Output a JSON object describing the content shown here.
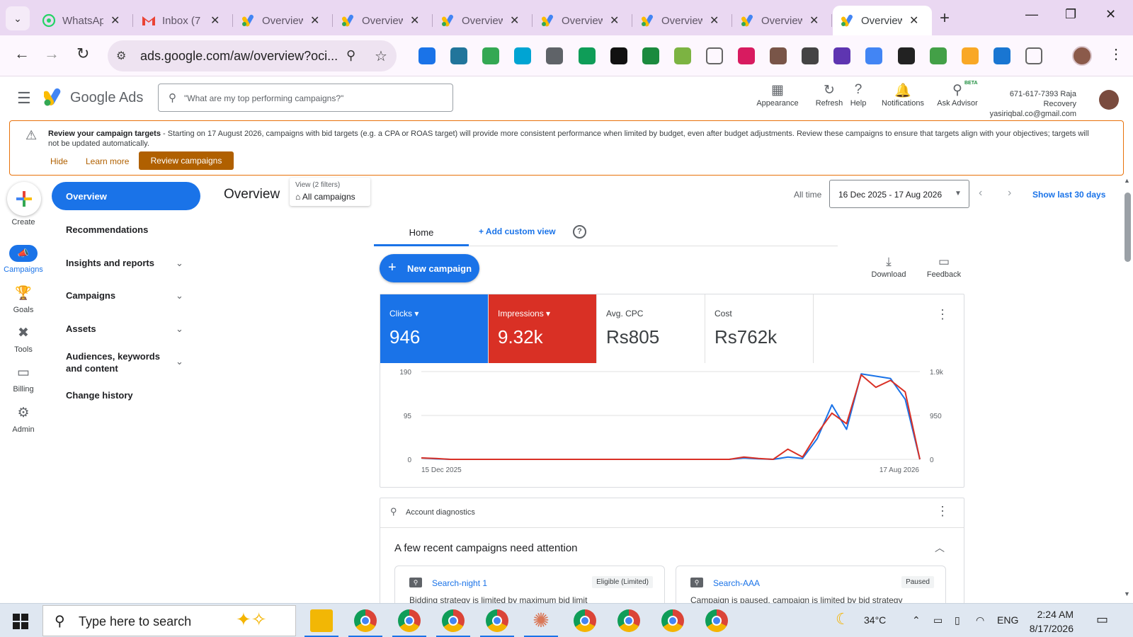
{
  "browser": {
    "tabs": [
      {
        "label": "WhatsApp",
        "icon": "whatsapp-icon",
        "color": "#25d366"
      },
      {
        "label": "Inbox (7",
        "icon": "gmail-icon",
        "color": "#ea4335"
      },
      {
        "label": "Overview",
        "icon": "google-ads-icon",
        "color": "#4285f4"
      },
      {
        "label": "Overview",
        "icon": "google-ads-icon",
        "color": "#4285f4"
      },
      {
        "label": "Overview",
        "icon": "google-ads-icon",
        "color": "#4285f4"
      },
      {
        "label": "Overview",
        "icon": "google-ads-icon",
        "color": "#4285f4"
      },
      {
        "label": "Overview",
        "icon": "google-ads-icon",
        "color": "#4285f4"
      },
      {
        "label": "Overview",
        "icon": "google-ads-icon",
        "color": "#4285f4"
      },
      {
        "label": "Overview",
        "icon": "google-ads-icon",
        "color": "#4285f4",
        "active": true
      }
    ],
    "url": "ads.google.com/aw/overview?oci..."
  },
  "ads_header": {
    "product": "Google Ads",
    "search_placeholder": "\"What are my top performing campaigns?\"",
    "tools": [
      {
        "label": "Appearance",
        "icon": "appearance-icon"
      },
      {
        "label": "Refresh",
        "icon": "refresh-icon"
      },
      {
        "label": "Help",
        "icon": "help-icon"
      },
      {
        "label": "Notifications",
        "icon": "bell-icon"
      },
      {
        "label": "Ask Advisor",
        "icon": "ask-advisor-icon"
      }
    ],
    "beta_badge": "BETA",
    "account_line1": "671-617-7393 Raja Recovery",
    "account_line2": "yasiriqbal.co@gmail.com"
  },
  "banner": {
    "title": "Review your campaign targets",
    "text": " - Starting on 17 August 2026, campaigns with bid targets (e.g. a CPA or ROAS target) will provide more consistent performance when limited by budget, even after budget adjustments. Review these campaigns to ensure that targets align with your objectives; targets will not be updated automatically.",
    "hide": "Hide",
    "learn_more": "Learn more",
    "review_btn": "Review campaigns"
  },
  "rail": {
    "create": "Create",
    "campaigns": "Campaigns",
    "goals": "Goals",
    "tools": "Tools",
    "billing": "Billing",
    "admin": "Admin"
  },
  "nav": {
    "overview": "Overview",
    "recommendations": "Recommendations",
    "insights": "Insights and reports",
    "campaigns": "Campaigns",
    "assets": "Assets",
    "audiences": "Audiences, keywords and content",
    "change_history": "Change history"
  },
  "main": {
    "title": "Overview",
    "view_filters": "View (2 filters)",
    "view_name": "All campaigns",
    "all_time": "All time",
    "date_range": "16 Dec 2025 - 17 Aug 2026",
    "show_last": "Show last 30 days",
    "home_tab": "Home",
    "add_custom_view": "Add custom view",
    "new_campaign": "New campaign",
    "download": "Download",
    "feedback": "Feedback"
  },
  "metrics": [
    {
      "label": "Clicks",
      "value": "946",
      "selected": true,
      "color": "#1a73e8"
    },
    {
      "label": "Impressions",
      "value": "9.32k",
      "selected": true,
      "color": "#d93025"
    },
    {
      "label": "Avg. CPC",
      "value": "Rs805",
      "selected": false
    },
    {
      "label": "Cost",
      "value": "Rs762k",
      "selected": false
    }
  ],
  "chart_data": {
    "type": "line",
    "x_start_label": "15 Dec 2025",
    "x_end_label": "17 Aug 2026",
    "y_left_ticks": [
      "190",
      "95",
      "0"
    ],
    "y_right_ticks": [
      "1.9k",
      "950",
      "0"
    ],
    "ylim_left": [
      0,
      190
    ],
    "ylim_right": [
      0,
      1900
    ],
    "grid": true,
    "series": [
      {
        "name": "Clicks",
        "axis": "left",
        "color": "#1a73e8",
        "values": [
          3,
          1,
          0,
          0,
          0,
          0,
          0,
          0,
          0,
          0,
          0,
          0,
          0,
          0,
          0,
          0,
          0,
          0,
          0,
          0,
          0,
          0,
          3,
          1,
          0,
          5,
          2,
          45,
          118,
          65,
          185,
          180,
          175,
          130,
          0
        ]
      },
      {
        "name": "Impressions",
        "axis": "right",
        "color": "#d93025",
        "values": [
          30,
          20,
          0,
          0,
          0,
          0,
          0,
          0,
          0,
          0,
          0,
          0,
          0,
          0,
          0,
          0,
          0,
          0,
          0,
          0,
          0,
          0,
          50,
          20,
          0,
          220,
          50,
          560,
          1000,
          770,
          1830,
          1560,
          1710,
          1460,
          0
        ]
      }
    ]
  },
  "diagnostics": {
    "header": "Account diagnostics",
    "title": "A few recent campaigns need attention",
    "campaigns": [
      {
        "name": "Search-night 1",
        "status": "Eligible (Limited)",
        "desc": "Bidding strategy is limited by maximum bid limit"
      },
      {
        "name": "Search-AAA",
        "status": "Paused",
        "desc": "Campaign is paused, campaign is limited by bid strategy"
      }
    ]
  },
  "taskbar": {
    "search_placeholder": "Type here to search",
    "weather": "34°C",
    "lang": "ENG",
    "time": "2:24 AM",
    "date": "8/17/2026"
  }
}
